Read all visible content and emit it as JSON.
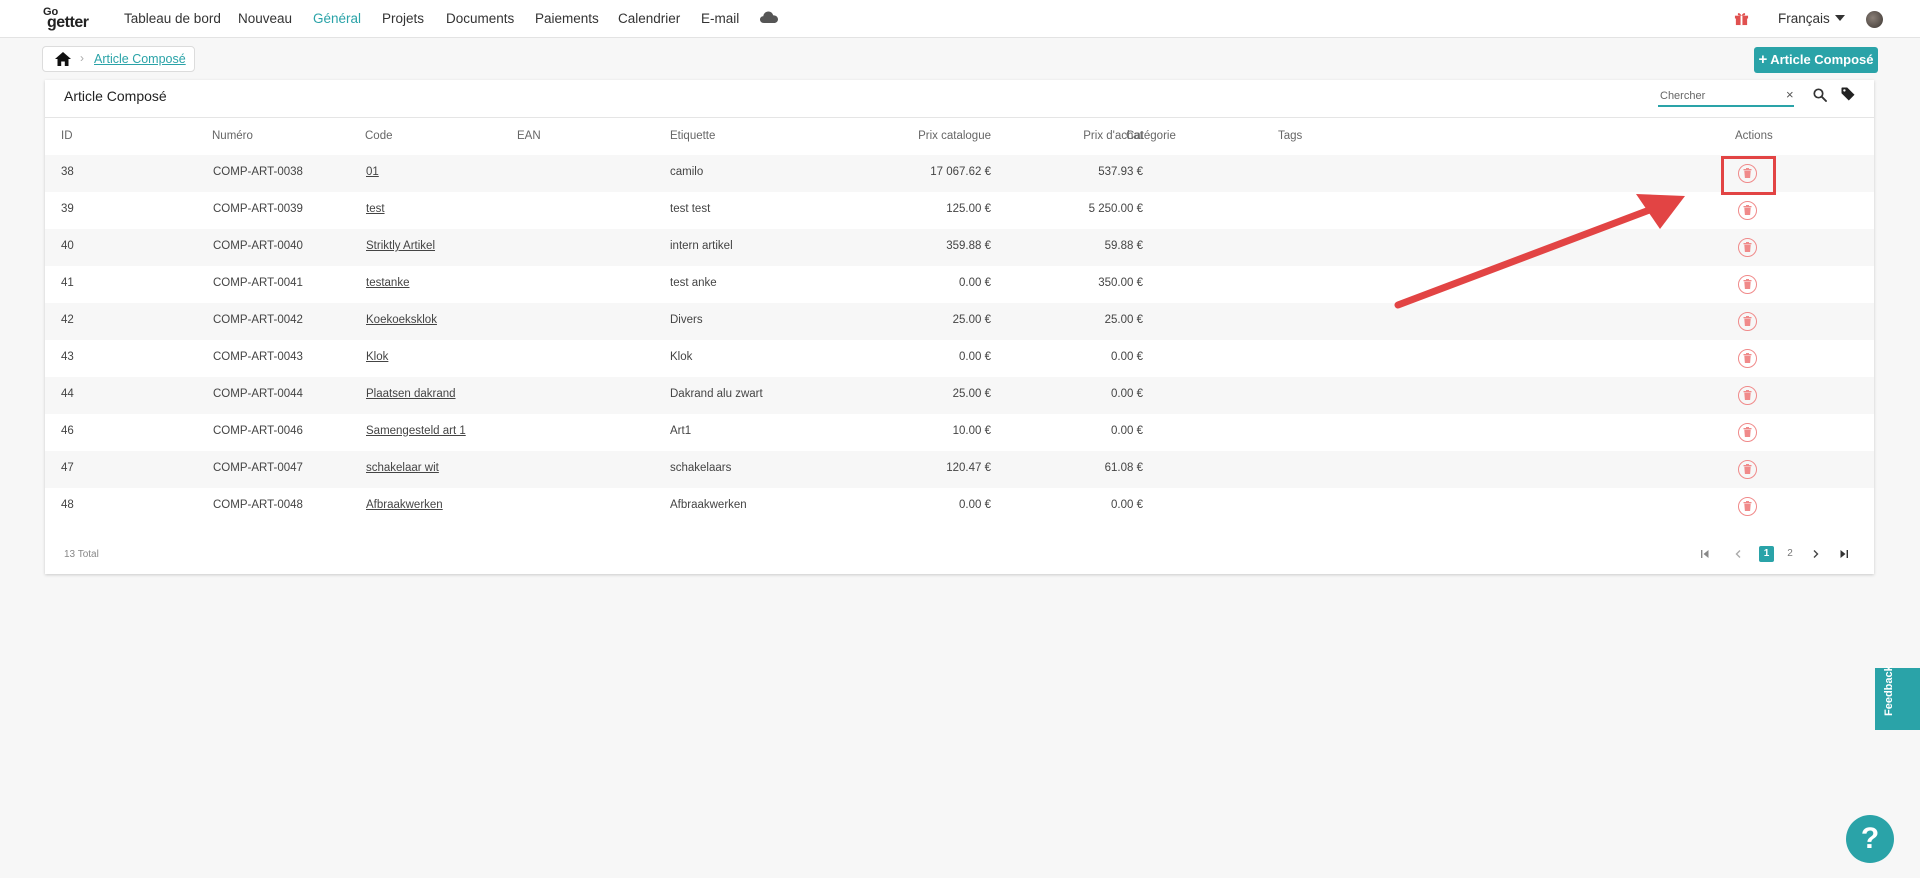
{
  "app": {
    "logo_go": "Go",
    "logo_getter": "getter"
  },
  "nav": {
    "items": [
      {
        "label": "Tableau de bord"
      },
      {
        "label": "Nouveau"
      },
      {
        "label": "Général",
        "active": true
      },
      {
        "label": "Projets"
      },
      {
        "label": "Documents"
      },
      {
        "label": "Paiements"
      },
      {
        "label": "Calendrier"
      },
      {
        "label": "E-mail"
      }
    ],
    "cloud_icon": "cloud-icon",
    "gift_icon": "gift-icon",
    "language": "Français",
    "avatar": "user-avatar"
  },
  "breadcrumb": {
    "home_icon": "home-icon",
    "current": "Article Composé"
  },
  "add_button": {
    "label": "Article Composé",
    "plus": "+"
  },
  "card": {
    "title": "Article Composé",
    "search_placeholder": "Chercher",
    "clear_symbol": "×"
  },
  "table": {
    "columns": [
      "ID",
      "Numéro",
      "Code",
      "EAN",
      "Etiquette",
      "Prix catalogue",
      "Prix d'achat",
      "Catégorie",
      "Tags",
      "Actions"
    ],
    "rows": [
      {
        "id": "38",
        "numero": "COMP-ART-0038",
        "code": "01",
        "ean": "",
        "etiquette": "camilo",
        "prix_catalogue": "17 067.62 €",
        "prix_achat": "537.93 €",
        "categorie": "",
        "tags": ""
      },
      {
        "id": "39",
        "numero": "COMP-ART-0039",
        "code": "test",
        "ean": "",
        "etiquette": "test test",
        "prix_catalogue": "125.00 €",
        "prix_achat": "5 250.00 €",
        "categorie": "",
        "tags": ""
      },
      {
        "id": "40",
        "numero": "COMP-ART-0040",
        "code": "Striktly Artikel",
        "ean": "",
        "etiquette": "intern artikel",
        "prix_catalogue": "359.88 €",
        "prix_achat": "59.88 €",
        "categorie": "",
        "tags": ""
      },
      {
        "id": "41",
        "numero": "COMP-ART-0041",
        "code": "testanke",
        "ean": "",
        "etiquette": "test anke",
        "prix_catalogue": "0.00 €",
        "prix_achat": "350.00 €",
        "categorie": "",
        "tags": ""
      },
      {
        "id": "42",
        "numero": "COMP-ART-0042",
        "code": "Koekoeksklok",
        "ean": "",
        "etiquette": "Divers",
        "prix_catalogue": "25.00 €",
        "prix_achat": "25.00 €",
        "categorie": "",
        "tags": ""
      },
      {
        "id": "43",
        "numero": "COMP-ART-0043",
        "code": "Klok",
        "ean": "",
        "etiquette": "Klok",
        "prix_catalogue": "0.00 €",
        "prix_achat": "0.00 €",
        "categorie": "",
        "tags": ""
      },
      {
        "id": "44",
        "numero": "COMP-ART-0044",
        "code": "Plaatsen dakrand",
        "ean": "",
        "etiquette": "Dakrand alu zwart",
        "prix_catalogue": "25.00 €",
        "prix_achat": "0.00 €",
        "categorie": "",
        "tags": ""
      },
      {
        "id": "46",
        "numero": "COMP-ART-0046",
        "code": "Samengesteld art 1",
        "ean": "",
        "etiquette": "Art1",
        "prix_catalogue": "10.00 €",
        "prix_achat": "0.00 €",
        "categorie": "",
        "tags": ""
      },
      {
        "id": "47",
        "numero": "COMP-ART-0047",
        "code": "schakelaar wit",
        "ean": "",
        "etiquette": "schakelaars",
        "prix_catalogue": "120.47 €",
        "prix_achat": "61.08 €",
        "categorie": "",
        "tags": ""
      },
      {
        "id": "48",
        "numero": "COMP-ART-0048",
        "code": "Afbraakwerken",
        "ean": "",
        "etiquette": "Afbraakwerken",
        "prix_catalogue": "0.00 €",
        "prix_achat": "0.00 €",
        "categorie": "",
        "tags": ""
      }
    ],
    "action_icon": "trash-icon"
  },
  "footer": {
    "total": "13 Total",
    "pages": [
      "1",
      "2"
    ],
    "current_page": "1"
  },
  "colors": {
    "accent": "#2aa3a8",
    "annotation": "#e24444",
    "delete": "#f08a8a"
  },
  "feedback": {
    "label": "Feedback"
  },
  "help": {
    "label": "?"
  }
}
